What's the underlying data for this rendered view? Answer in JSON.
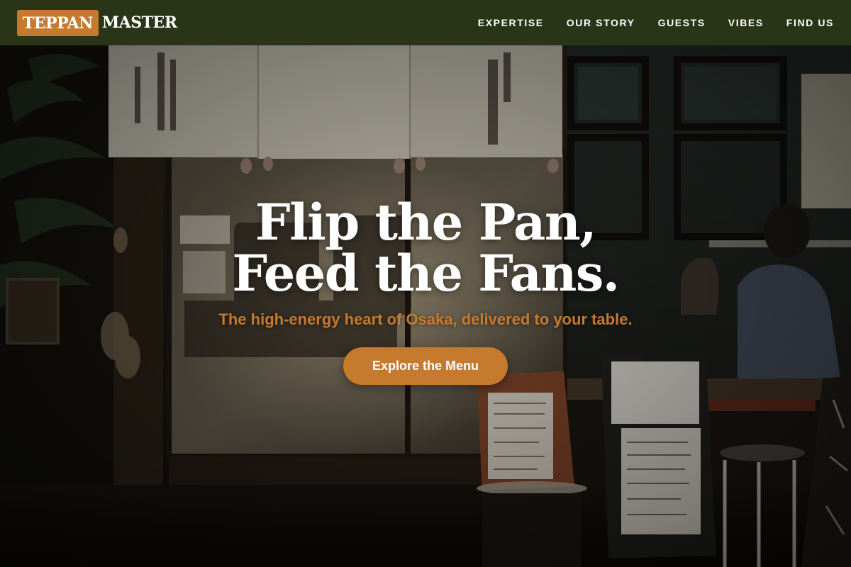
{
  "brand": {
    "highlight": "TEPPAN",
    "rest": "MASTER",
    "accent_color": "#c67a2e",
    "nav_bg": "#2a3518"
  },
  "nav": {
    "links": [
      {
        "label": "EXPERTISE"
      },
      {
        "label": "OUR STORY"
      },
      {
        "label": "GUESTS"
      },
      {
        "label": "VIBES"
      },
      {
        "label": "FIND US"
      }
    ]
  },
  "hero": {
    "headline_line1": "Flip the Pan,",
    "headline_line2": "Feed the Fans.",
    "tagline": "The high-energy heart of Osaka, delivered to your table.",
    "cta_label": "Explore the Menu",
    "background_image": "night-restaurant-storefront-photo"
  }
}
